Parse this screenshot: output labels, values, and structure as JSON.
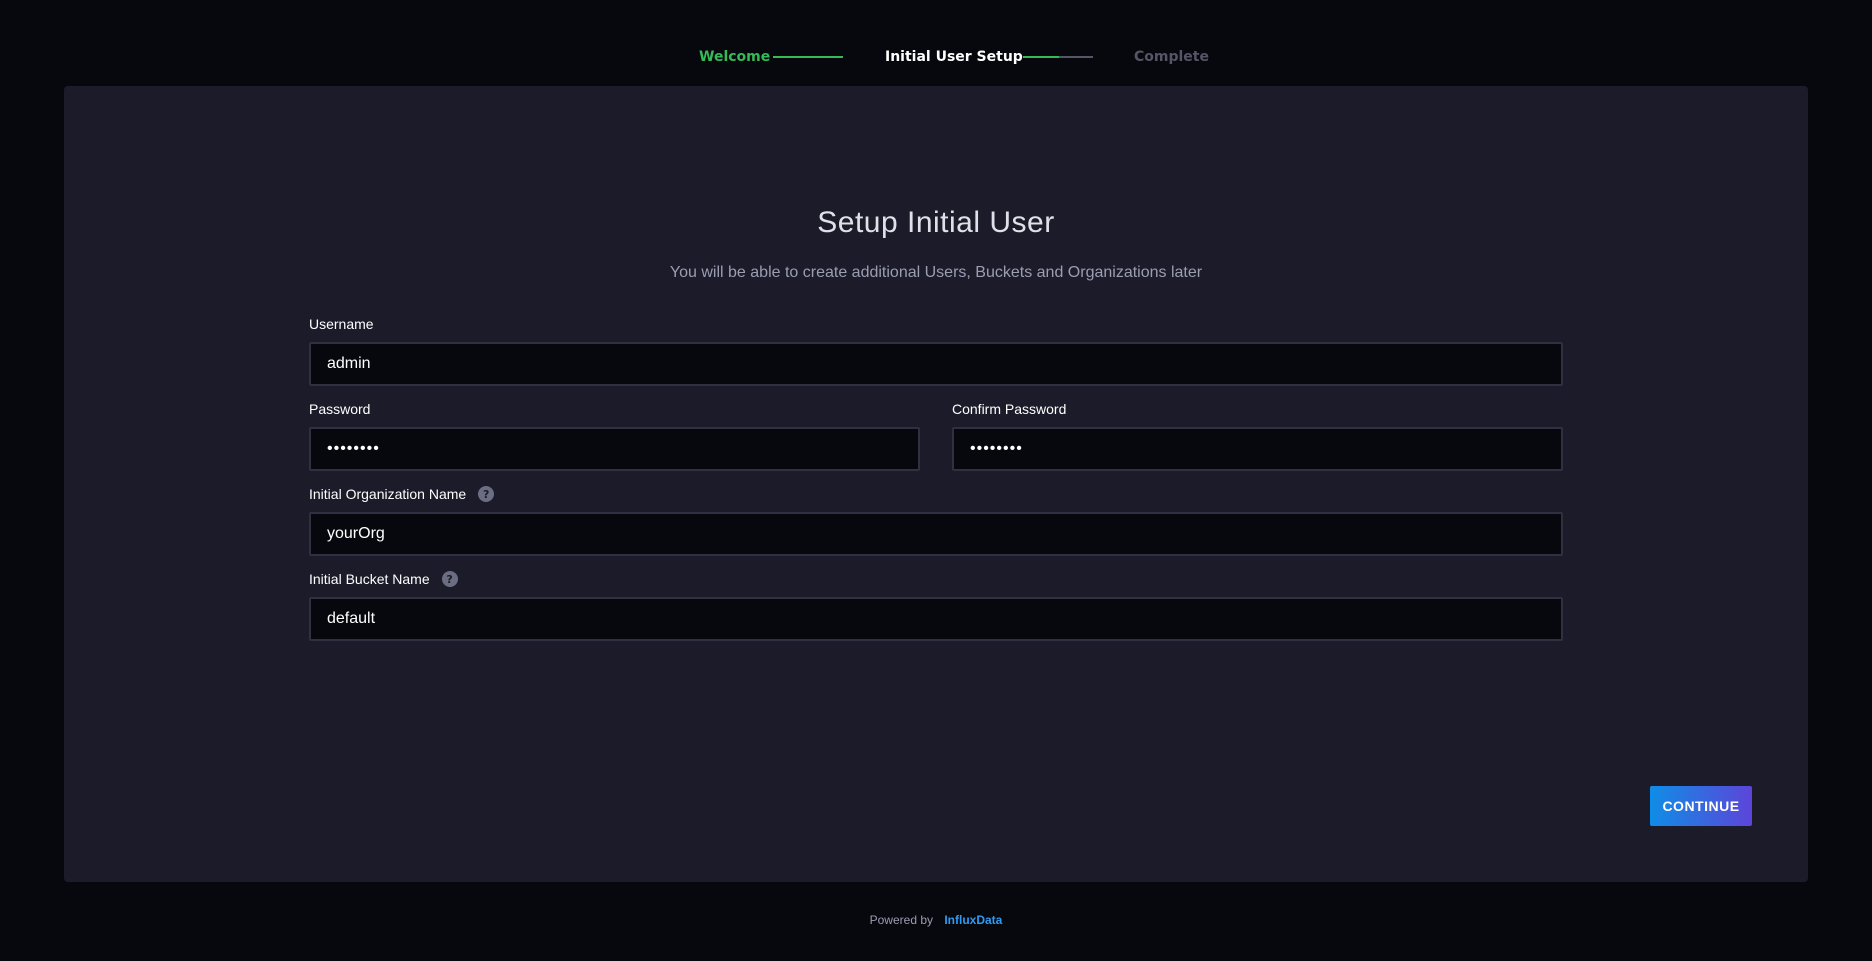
{
  "stepper": {
    "steps": [
      {
        "label": "Welcome",
        "state": "done"
      },
      {
        "label": "Initial User Setup",
        "state": "current"
      },
      {
        "label": "Complete",
        "state": "pending"
      }
    ]
  },
  "colors": {
    "success": "#34bb55",
    "pending": "#545667",
    "panel_bg": "#1b1b29",
    "page_bg": "#07080d",
    "link": "#2f9bf3",
    "button_gradient_start": "#0f8de6",
    "button_gradient_end": "#5c45d9"
  },
  "form": {
    "title": "Setup Initial User",
    "subtitle": "You will be able to create additional Users, Buckets and Organizations later",
    "username": {
      "label": "Username",
      "value": "admin"
    },
    "password": {
      "label": "Password",
      "value": "••••••••"
    },
    "confirm_password": {
      "label": "Confirm Password",
      "value": "••••••••"
    },
    "org_name": {
      "label": "Initial Organization Name",
      "value": "yourOrg",
      "help_icon": "question-circle-icon",
      "help_glyph": "?"
    },
    "bucket_name": {
      "label": "Initial Bucket Name",
      "value": "default",
      "help_icon": "question-circle-icon",
      "help_glyph": "?"
    },
    "continue_label": "CONTINUE"
  },
  "footer": {
    "powered_by": "Powered by",
    "brand": "InfluxData"
  }
}
